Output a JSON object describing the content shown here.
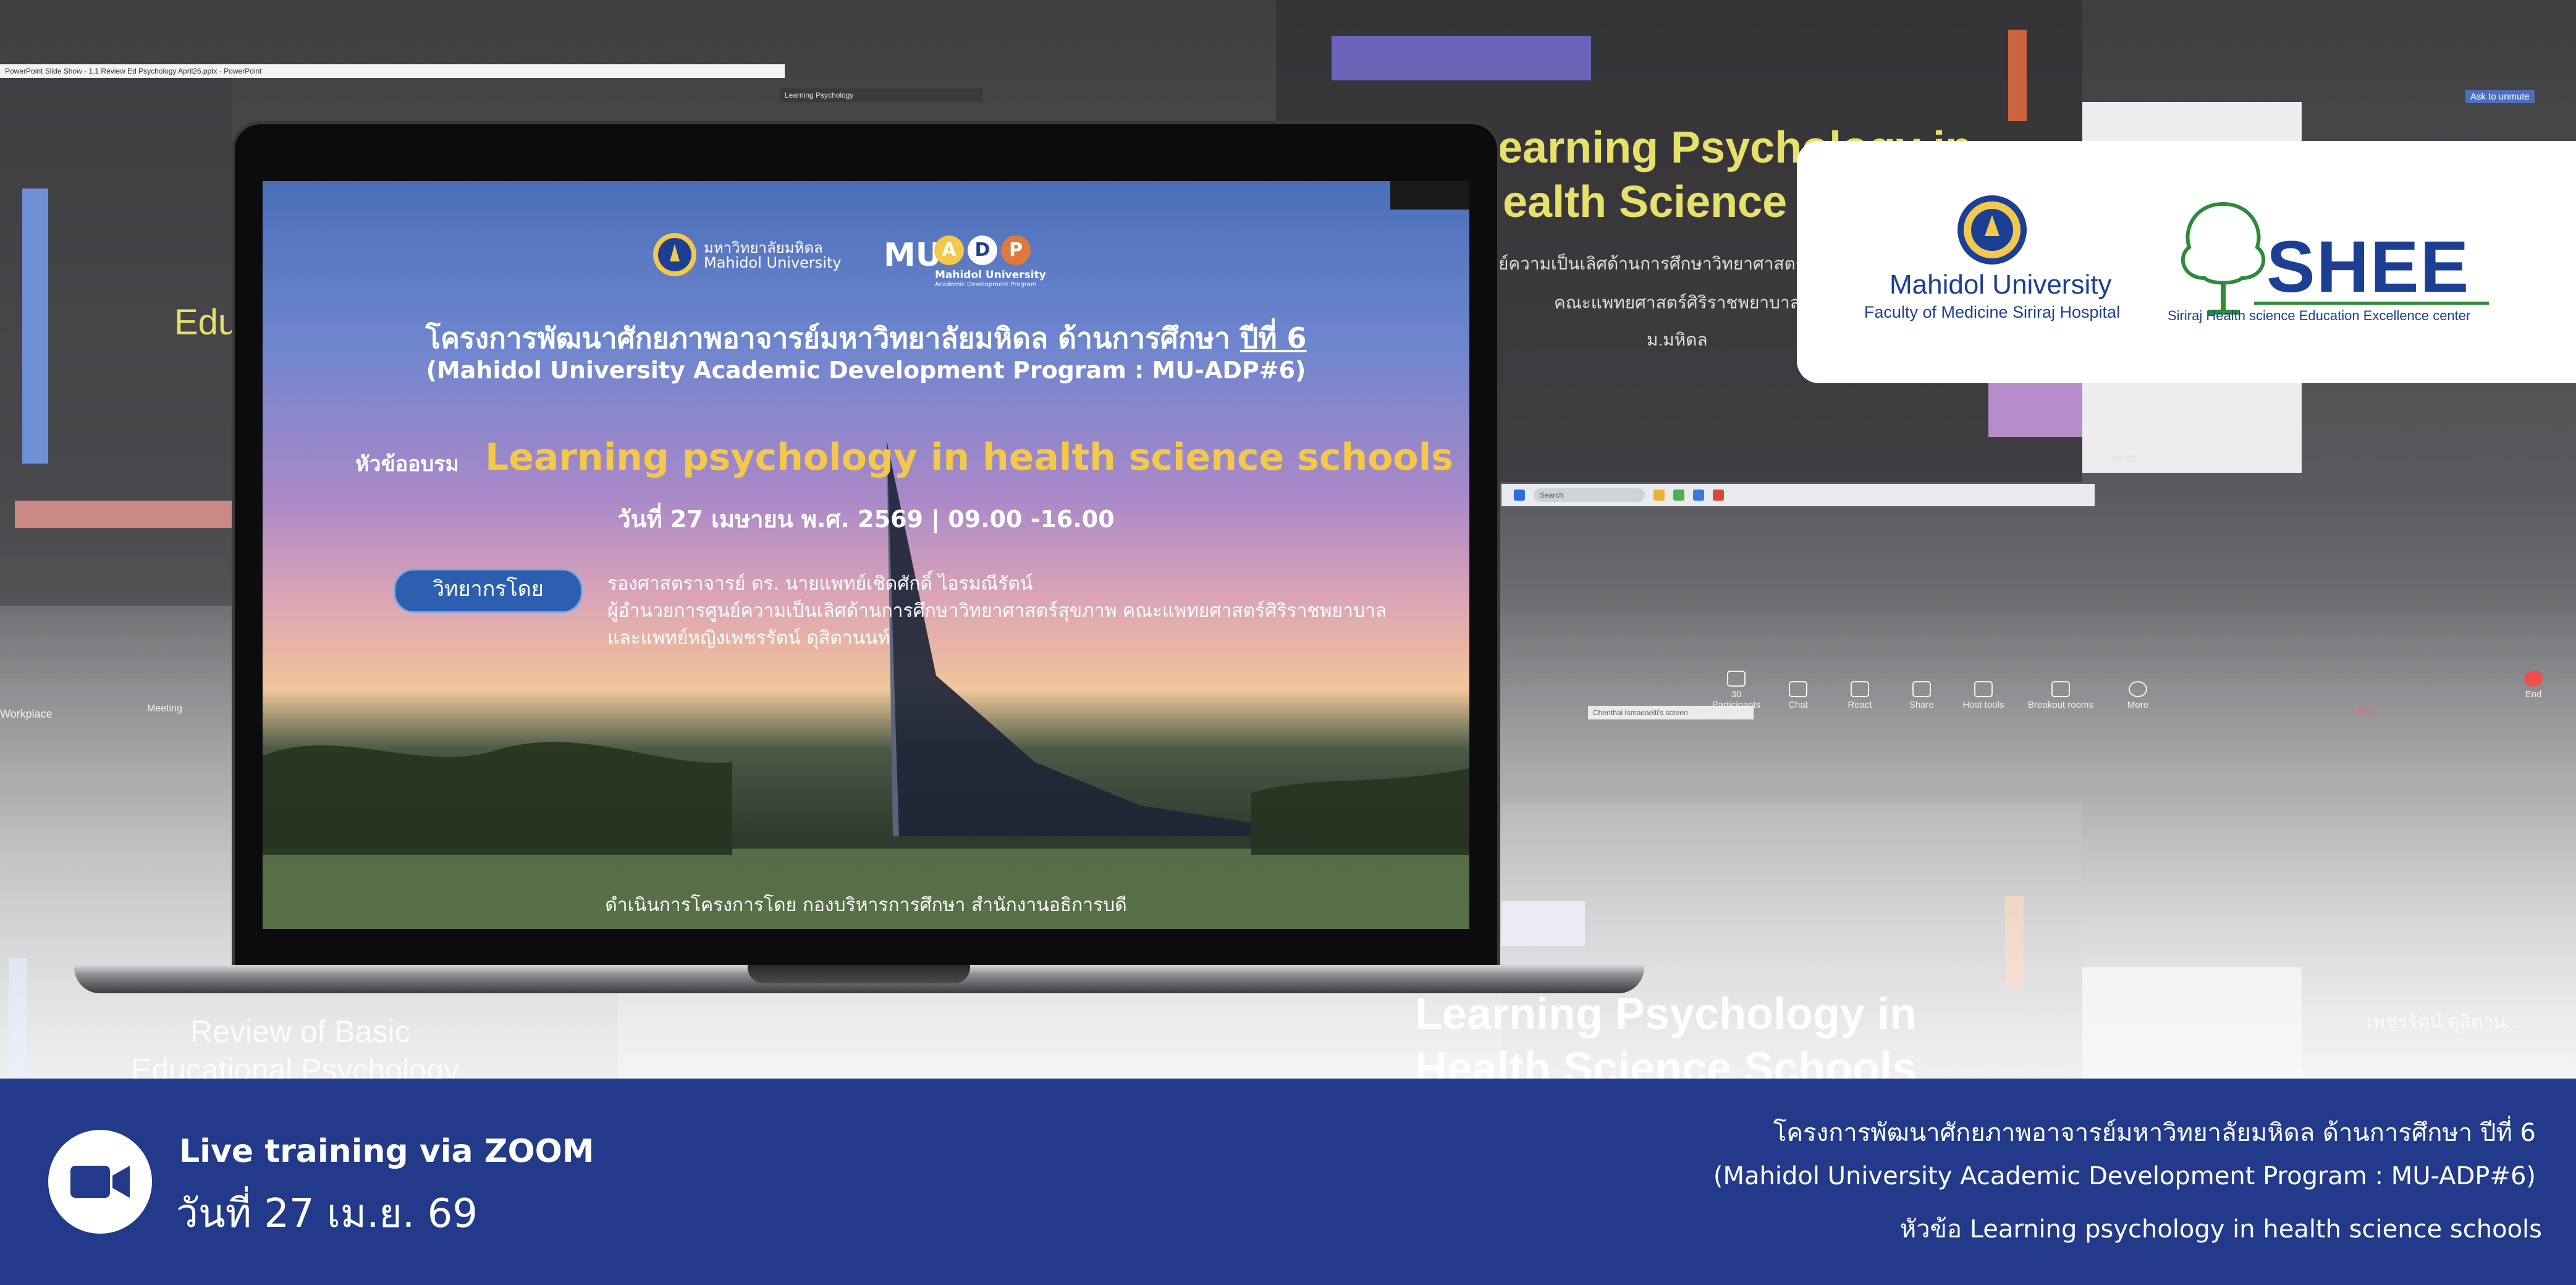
{
  "background": {
    "bg_titles": [
      "Learning Psychology in",
      "Health Science Schools",
      "Edu",
      "Review of Basic",
      "Educational Psychology",
      "Learning Psychology in",
      "Health Science Schools"
    ],
    "bg_thai_lines": [
      "ย์ความเป็นเลิศด้านการศึกษาวิทยาศาสตร์",
      "คณะแพทยศาสตร์ศิริราชพยาบาล",
      "ม.มหิดล"
    ],
    "ask_unmute": "Ask to unmute",
    "timer": "00:00",
    "search_placeholder": "Search",
    "window_title": "PowerPoint Slide Show - 1.1 Review Ed Psychology April26.pptx - PowerPoint",
    "tab_title": "Learning Psychology",
    "meeting_label": "Meeting",
    "workplace_label": "Workplace",
    "share_tab": "Chenthai Ismaeaeiti's screen",
    "speaker_name_bg": "เพชรรัตน์ ดุสิตาน...",
    "zoom_toolbar": [
      "Participants",
      "Chat",
      "React",
      "Share",
      "Host tools",
      "Breakout rooms",
      "More",
      "End"
    ],
    "participant_count": "30",
    "rec_label": "REC"
  },
  "logo_card": {
    "mahidol_name": "Mahidol University",
    "mahidol_sub": "Faculty of Medicine Siriraj Hospital",
    "shee_title": "SHEE",
    "shee_sub": "Siriraj Health science Education Excellence center"
  },
  "slide": {
    "logo_thai": "มหาวิทยาลัยมหิดล",
    "logo_en": "Mahidol University",
    "mu_text": "MU",
    "adp_letters": [
      "A",
      "D",
      "P"
    ],
    "adp_sub1": "Mahidol University",
    "adp_sub2": "Academic Development Program",
    "title_thai_main": "โครงการพัฒนาศักยภาพอาจารย์มหาวิทยาลัยมหิดล ด้านการศึกษา ",
    "title_thai_year": "ปีที่ 6",
    "title_en": "(Mahidol University Academic Development Program : MU-ADP#6)",
    "topic_label": "หัวข้ออบรม",
    "topic_title": "Learning psychology in health science schools",
    "date_line": "วันที่ 27 เมษายน พ.ศ. 2569 | 09.00 -16.00",
    "speaker_button": "วิทยากรโดย",
    "speaker_line1": "รองศาสตราจารย์ ดร. นายแพทย์เชิดศักดิ์ ไอรมณีรัตน์",
    "speaker_line2": "ผู้อำนวยการศูนย์ความเป็นเลิศด้านการศึกษาวิทยาศาสตร์สุขภาพ คณะแพทยศาสตร์ศิริราชพยาบาล",
    "speaker_line3": "และแพทย์หญิงเพชรรัตน์ ดุสิตานนท์",
    "footer": "ดำเนินการโครงการโดย กองบริหารการศึกษา สำนักงานอธิการบดี"
  },
  "band": {
    "live_label": "Live training via ZOOM",
    "date": "วันที่ 27 เม.ย. 69",
    "right_line1": "โครงการพัฒนาศักยภาพอาจารย์มหาวิทยาลัยมหิดล ด้านการศึกษา ปีที่ 6",
    "right_line2": "(Mahidol University Academic Development Program : MU-ADP#6)",
    "right_line3": "หัวข้อ Learning psychology in health science schools"
  },
  "colors": {
    "band_bg": "#233a8b",
    "topic_yellow": "#f4c84a",
    "mahidol_blue": "#1c3f94",
    "shee_green": "#2f8a3a"
  }
}
